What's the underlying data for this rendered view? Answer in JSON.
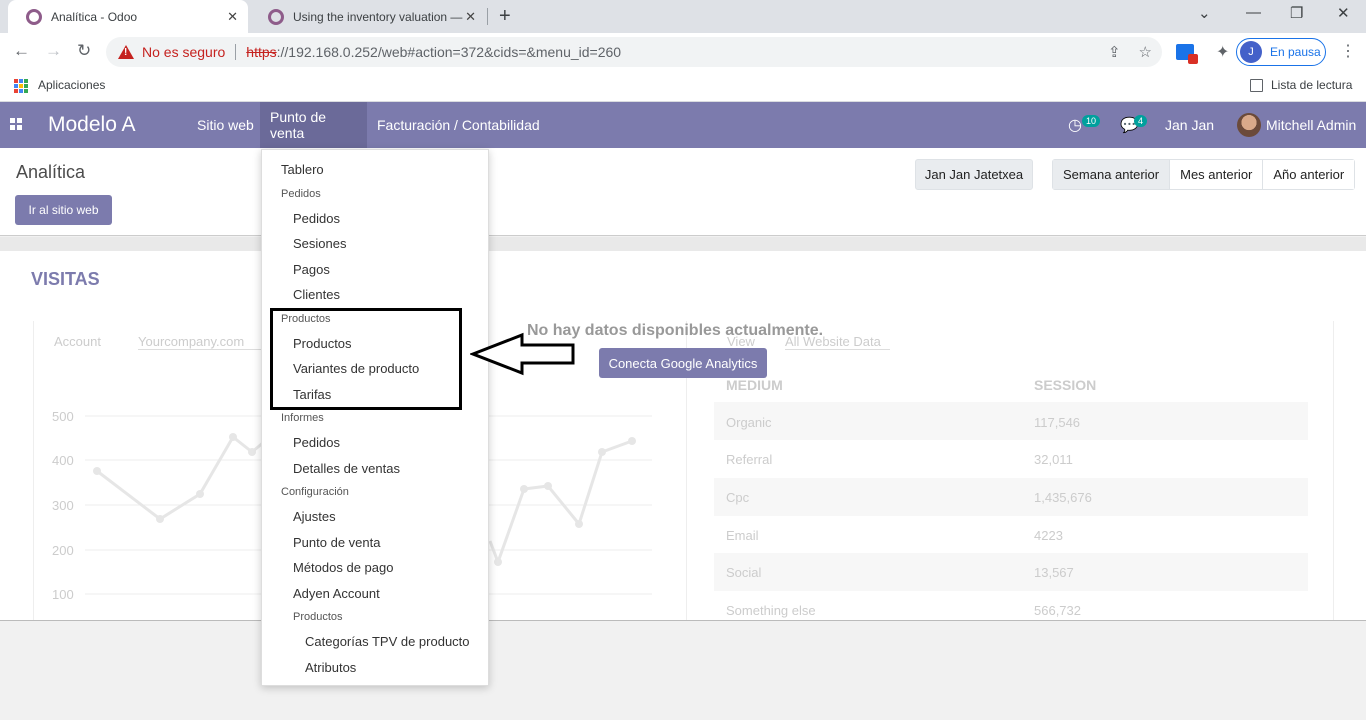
{
  "browser": {
    "tabs": [
      {
        "title": "Analítica - Odoo",
        "active": true
      },
      {
        "title": "Using the inventory valuation —",
        "active": false
      }
    ],
    "security_label": "No es seguro",
    "url_scheme": "https",
    "url_rest": "://192.168.0.252/web#action=372&cids=&menu_id=260",
    "profile_initial": "J",
    "profile_status": "En pausa",
    "bookmarks": {
      "apps": "Aplicaciones",
      "reading_list": "Lista de lectura"
    }
  },
  "navbar": {
    "brand": "Modelo A",
    "menus": [
      "Sitio web",
      "Punto de venta",
      "Facturación / Contabilidad"
    ],
    "activity_count": "10",
    "message_count": "4",
    "company": "Jan Jan",
    "user": "Mitchell Admin",
    "accent": "#7c7bad"
  },
  "control_panel": {
    "title": "Analítica",
    "go_website": "Ir al sitio web",
    "user_filter": "Jan Jan Jatetxea",
    "periods": [
      "Semana anterior",
      "Mes anterior",
      "Año anterior"
    ]
  },
  "content": {
    "section_title": "VISITAS",
    "no_data": "No hay datos disponibles actualmente.",
    "connect_ga": "Conecta Google Analytics",
    "ghost": {
      "account_label": "Account",
      "account_value": "Yourcompany.com",
      "view_label": "View",
      "view_value": "All Website Data",
      "y_ticks": [
        "500",
        "400",
        "300",
        "200",
        "100"
      ],
      "table_headers": [
        "MEDIUM",
        "SESSION"
      ],
      "rows": [
        {
          "medium": "Organic",
          "session": "117,546"
        },
        {
          "medium": "Referral",
          "session": "32,011"
        },
        {
          "medium": "Cpc",
          "session": "1,435,676"
        },
        {
          "medium": "Email",
          "session": "4223"
        },
        {
          "medium": "Social",
          "session": "13,567"
        },
        {
          "medium": "Something else",
          "session": "566,732"
        }
      ]
    }
  },
  "dropdown": {
    "dashboard": "Tablero",
    "orders_header": "Pedidos",
    "orders_items": [
      "Pedidos",
      "Sesiones",
      "Pagos",
      "Clientes"
    ],
    "products_header": "Productos",
    "products_items": [
      "Productos",
      "Variantes de producto",
      "Tarifas"
    ],
    "reports_header": "Informes",
    "reports_items": [
      "Pedidos",
      "Detalles de ventas"
    ],
    "config_header": "Configuración",
    "config_items": [
      "Ajustes",
      "Punto de venta",
      "Métodos de pago",
      "Adyen Account"
    ],
    "config_products_header": "Productos",
    "config_products_items": [
      "Categorías TPV de producto",
      "Atributos"
    ]
  }
}
